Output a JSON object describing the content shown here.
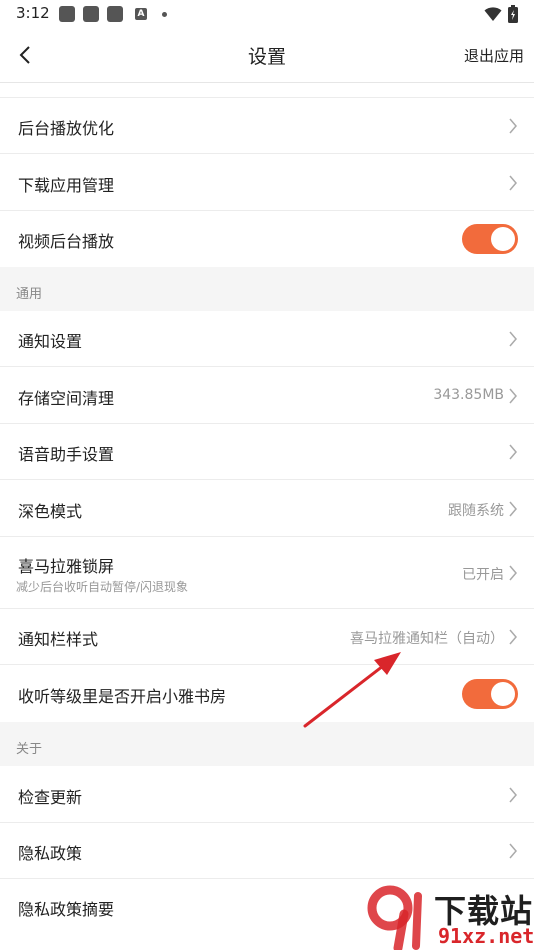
{
  "status_bar": {
    "time": "3:12",
    "a_icon": "A"
  },
  "header": {
    "title": "设置",
    "exit_label": "退出应用"
  },
  "rows_top": [
    {
      "label": "后台播放优化"
    },
    {
      "label": "下载应用管理"
    },
    {
      "label": "视频后台播放",
      "toggle": true
    }
  ],
  "sections": {
    "general": "通用",
    "about": "关于"
  },
  "rows_general": [
    {
      "label": "通知设置"
    },
    {
      "label": "存储空间清理",
      "value": "343.85MB"
    },
    {
      "label": "语音助手设置"
    },
    {
      "label": "深色模式",
      "value": "跟随系统"
    },
    {
      "label": "喜马拉雅锁屏",
      "sub": "减少后台收听自动暂停/闪退现象",
      "value": "已开启"
    },
    {
      "label": "通知栏样式",
      "value": "喜马拉雅通知栏（自动）"
    },
    {
      "label": "收听等级里是否开启小雅书房",
      "toggle": true
    }
  ],
  "rows_about": [
    {
      "label": "检查更新"
    },
    {
      "label": "隐私政策"
    },
    {
      "label": "隐私政策摘要"
    }
  ],
  "watermark": {
    "brand": "下载站",
    "url": "91xz.net"
  },
  "colors": {
    "accent": "#f26b3c",
    "annotation_arrow": "#d9262b"
  }
}
